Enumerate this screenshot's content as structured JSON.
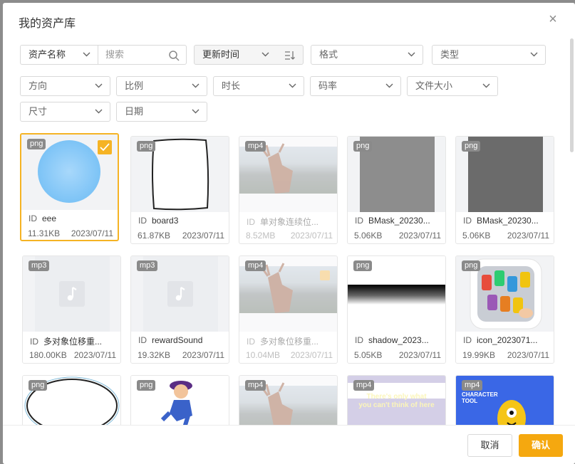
{
  "dialog": {
    "title": "我的资产库",
    "close": "×"
  },
  "filters": {
    "asset_name": "资产名称",
    "search_placeholder": "搜索",
    "update_time": "更新时间",
    "format": "格式",
    "type": "类型",
    "direction": "方向",
    "ratio": "比例",
    "duration": "时长",
    "bitrate": "码率",
    "file_size": "文件大小",
    "dimension": "尺寸",
    "date": "日期"
  },
  "id_label": "ID",
  "assets": [
    {
      "badge": "png",
      "name": "eee",
      "size": "11.31KB",
      "date": "2023/07/11",
      "selected": true,
      "dim": false,
      "thumb": "circle-blue"
    },
    {
      "badge": "png",
      "name": "board3",
      "size": "61.87KB",
      "date": "2023/07/11",
      "selected": false,
      "dim": false,
      "thumb": "board"
    },
    {
      "badge": "mp4",
      "name": "单对象连续位...",
      "size": "8.52MB",
      "date": "2023/07/11",
      "selected": false,
      "dim": true,
      "thumb": "deer"
    },
    {
      "badge": "png",
      "name": "BMask_20230...",
      "size": "5.06KB",
      "date": "2023/07/11",
      "selected": false,
      "dim": false,
      "thumb": "gray-light"
    },
    {
      "badge": "png",
      "name": "BMask_20230...",
      "size": "5.06KB",
      "date": "2023/07/11",
      "selected": false,
      "dim": false,
      "thumb": "gray-dark"
    },
    {
      "badge": "mp3",
      "name": "多对象位移重...",
      "size": "180.00KB",
      "date": "2023/07/11",
      "selected": false,
      "dim": false,
      "thumb": "audio"
    },
    {
      "badge": "mp3",
      "name": "rewardSound",
      "size": "19.32KB",
      "date": "2023/07/11",
      "selected": false,
      "dim": false,
      "thumb": "audio"
    },
    {
      "badge": "mp4",
      "name": "多对象位移重...",
      "size": "10.04MB",
      "date": "2023/07/11",
      "selected": false,
      "dim": true,
      "thumb": "deer"
    },
    {
      "badge": "png",
      "name": "shadow_2023...",
      "size": "5.05KB",
      "date": "2023/07/11",
      "selected": false,
      "dim": false,
      "thumb": "shadow"
    },
    {
      "badge": "png",
      "name": "icon_2023071...",
      "size": "19.99KB",
      "date": "2023/07/11",
      "selected": false,
      "dim": false,
      "thumb": "cars"
    },
    {
      "badge": "png",
      "thumb": "ellipse",
      "dim": false
    },
    {
      "badge": "png",
      "thumb": "character",
      "dim": false
    },
    {
      "badge": "mp4",
      "thumb": "deer",
      "dim": true
    },
    {
      "badge": "mp4",
      "thumb": "video-text",
      "dim": true,
      "overlay_line1": "There's only what",
      "overlay_line2": "you can't think of here"
    },
    {
      "badge": "mp4",
      "thumb": "char-tool",
      "dim": false,
      "overlay_line1": "CHARACTER",
      "overlay_line2": "TOOL"
    }
  ],
  "footer": {
    "cancel": "取消",
    "confirm": "确认"
  },
  "colors": {
    "accent": "#f5a80f",
    "selected_border": "#f5b324"
  }
}
